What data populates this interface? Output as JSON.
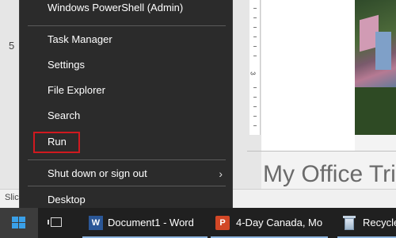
{
  "background": {
    "slide_number": "5",
    "ruler_number": "3",
    "slide_title": "My Office Tric",
    "status_left": "Slic"
  },
  "menu": {
    "items": [
      {
        "label": "Windows PowerShell (Admin)"
      },
      {
        "label": "Task Manager"
      },
      {
        "label": "Settings"
      },
      {
        "label": "File Explorer"
      },
      {
        "label": "Search"
      },
      {
        "label": "Run"
      },
      {
        "label": "Shut down or sign out",
        "has_submenu": true,
        "chevron_icon": "chevron-right-icon"
      },
      {
        "label": "Desktop"
      }
    ],
    "highlighted_item": "Run",
    "highlight_color": "#d0191f"
  },
  "taskbar": {
    "start_icon": "windows-logo-icon",
    "task_view_icon": "task-view-icon",
    "apps": [
      {
        "label": "Document1 - Word",
        "icon": "word-icon",
        "icon_letter": "W"
      },
      {
        "label": "4-Day Canada, Mo",
        "icon": "powerpoint-icon",
        "icon_letter": "P"
      },
      {
        "label": "Recycle",
        "icon": "recycle-bin-icon"
      }
    ]
  },
  "colors": {
    "menu_bg": "#2b2b2b",
    "taskbar_bg": "#202020",
    "accent_blue": "#3aa0e8"
  }
}
